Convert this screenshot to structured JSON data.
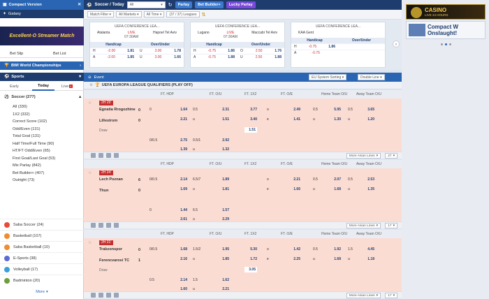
{
  "left": {
    "compact_label": "Compact Version",
    "galaxy_label": "Galaxy",
    "banner_text": "Excellent-O Streamer Match",
    "betslip": "Bet Slip",
    "betlist": "Bet List",
    "championship": "BWI World Championships",
    "sports_label": "Sports",
    "tabs": [
      "Early",
      "Today",
      "Live"
    ],
    "live_badge": "1",
    "soccer": "Soccer (277)",
    "soccer_items": [
      "All (330)",
      "1X2 (332)",
      "Correct Score (102)",
      "Odd/Even (131)",
      "Total Goal (131)",
      "Half Time/Full Time (90)",
      "HT/FT Odd/Even (65)",
      "First Goal/Last Goal (53)",
      "Mix Parlay (842)",
      "Bet Builder+ (407)",
      "Outright (73)"
    ],
    "nav": [
      {
        "label": "Saba Soccer (24)",
        "color": "#e94b35"
      },
      {
        "label": "Basketball (107)",
        "color": "#f08c2e"
      },
      {
        "label": "Saba Basketball (10)",
        "color": "#f08c2e"
      },
      {
        "label": "E-Sports (38)",
        "color": "#5b6bd6"
      },
      {
        "label": "Volleyball (17)",
        "color": "#3aa0d8"
      },
      {
        "label": "Badminton (20)",
        "color": "#6c9e3a"
      }
    ],
    "more": "More"
  },
  "top": {
    "sport": "Soccer / Today",
    "sel": "All",
    "parlay": "Parlay",
    "builder": "Bet Builder+",
    "lucky": "Lucky Parlay"
  },
  "filters": {
    "match": "Match Filter",
    "markets": "All Markets",
    "time": "All Time",
    "leagues": "(37 / 37) Leagues"
  },
  "featured": [
    {
      "league": "UEFA CONFERENCE LEA...",
      "home": "Atalanta",
      "away": "Hapoel Tel Aviv",
      "live": "LIVE",
      "time": "07:30AM",
      "rows": [
        [
          "H",
          "-2.00",
          "1.81",
          "U",
          "3.00",
          "1.78"
        ],
        [
          "A",
          "-2.00",
          "1.85",
          "U",
          "3.00",
          "1.66"
        ]
      ]
    },
    {
      "league": "UEFA CONFERENCE LEA...",
      "home": "Lugano",
      "away": "Maccabi Tel Aviv",
      "live": "LIVE",
      "time": "07:30AM",
      "rows": [
        [
          "H",
          "-0.75",
          "1.86",
          "O",
          "2.50",
          "1.76"
        ],
        [
          "A",
          "-0.75",
          "1.88",
          "U",
          "2.50",
          "1.88"
        ]
      ]
    },
    {
      "league": "UEFA CONFERENCE LEA...",
      "home": "KAA Gent",
      "away": "",
      "live": "",
      "time": "",
      "rows": [
        [
          "H",
          "-0.75",
          "1.86",
          "",
          "",
          " "
        ],
        [
          "A",
          "-0.75",
          "",
          "",
          "",
          ""
        ]
      ]
    }
  ],
  "featured_hdr": [
    "Handicap",
    "Over/Under"
  ],
  "events": {
    "event_label": "Event",
    "sorting": "EU System Sorting",
    "double": "Double Line",
    "league": "UEFA EUROPA LEAGUE QUALIFIERS (PLAY OFF)",
    "cols": [
      "FT. HDP",
      "FT. O/U",
      "FT. 1X2",
      "FT. O/E",
      "Home Team O/U",
      "Away Team O/U"
    ],
    "more": "More Asian Lines",
    "matches": [
      {
        "tag": "2H 29'",
        "home": "Egnatia Rrogozhine",
        "away": "Lillestrom",
        "hs": "0",
        "as": "0",
        "draw": "Draw",
        "r1": [
          "0",
          "1.64",
          "0.5",
          "2.31",
          "3.77",
          "o",
          "2.49",
          "0.5",
          "5.95",
          "0.5",
          "3.65"
        ],
        "r2": [
          "",
          "2.21",
          "u",
          "1.51",
          "3.40",
          "e",
          "1.41",
          "u",
          "1.30",
          "u",
          "1.20"
        ],
        "r3": [
          "",
          "",
          "",
          "",
          "1.51"
        ],
        "r4": [
          "0/0.5",
          "2.75",
          "0.5/1",
          "2.92"
        ],
        "r5": [
          "",
          "1.39",
          "u",
          "1.32"
        ],
        "count": "27"
      },
      {
        "tag": "2H 24'",
        "home": "Lech Poznan",
        "away": "Thun",
        "hs": "6",
        "as": "0",
        "draw": "",
        "r1": [
          "0/0.5",
          "2.14",
          "6.5/7",
          "1.89",
          "",
          "o",
          "2.21",
          "0.5",
          "2.07",
          "0.5",
          "2.53"
        ],
        "r2": [
          "",
          "1.69",
          "u",
          "1.81",
          "",
          "e",
          "1.66",
          "u",
          "1.68",
          "u",
          "1.35"
        ],
        "r3": [],
        "r4": [
          "0",
          "1.44",
          "6.5",
          "1.57"
        ],
        "r5": [
          "",
          "2.61",
          "u",
          "2.29"
        ],
        "count": "17"
      },
      {
        "tag": "2H 21'",
        "home": "Trabzonspor",
        "away": "Ferencvarosi TC",
        "hs": "0",
        "as": "1",
        "draw": "Draw",
        "r1": [
          "0/0.5",
          "1.68",
          "1.5/2",
          "1.95",
          "5.30",
          "o",
          "1.42",
          "0.5",
          "1.92",
          "1.5",
          "4.45"
        ],
        "r2": [
          "",
          "2.16",
          "u",
          "1.85",
          "1.72",
          "e",
          "2.25",
          "u",
          "1.68",
          "u",
          "1.18"
        ],
        "r3": [
          "",
          "",
          "",
          "",
          "3.05"
        ],
        "r4": [
          "0.5",
          "2.14",
          "1.5",
          "1.62"
        ],
        "r5": [
          "",
          "1.60",
          "u",
          "2.21"
        ],
        "count": "17"
      }
    ]
  },
  "right": {
    "ad1_title": "CASINO",
    "ad1_sub": "LIVE 24 HOURS",
    "ad2_title": "Compact W",
    "ad2_sub": "Onslaught!"
  }
}
